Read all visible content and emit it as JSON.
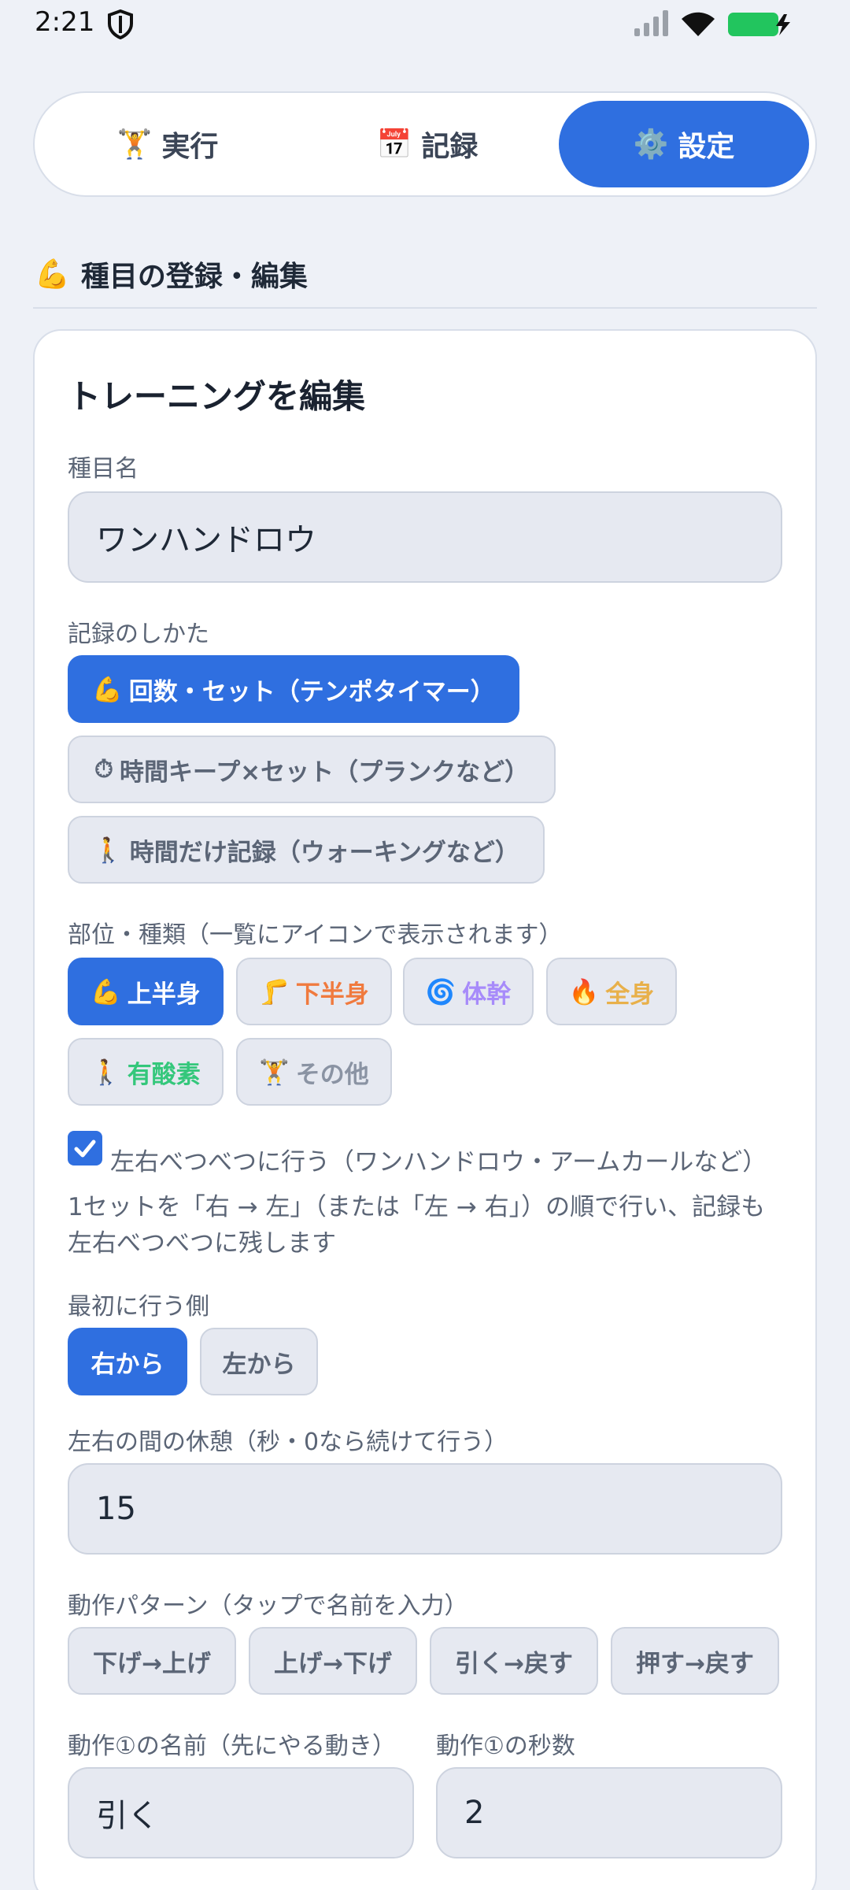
{
  "status": {
    "time": "2:21",
    "shield_icon": "shield-icon",
    "signal_icon": "signal-icon",
    "wifi_icon": "wifi-icon",
    "battery_icon": "battery-charging-icon",
    "battery_color": "#22c55e"
  },
  "tabs": [
    {
      "icon": "🏋️",
      "label": "実行"
    },
    {
      "icon": "📅",
      "label": "記録"
    },
    {
      "icon": "⚙️",
      "label": "設定"
    }
  ],
  "section": {
    "icon": "💪",
    "title": "種目の登録・編集"
  },
  "card": {
    "title": "トレーニングを編集",
    "name_label": "種目名",
    "name_value": "ワンハンドロウ",
    "record_label": "記録のしかた",
    "record_options": [
      {
        "icon": "💪",
        "label": "回数・セット（テンポタイマー）"
      },
      {
        "icon": "⏱",
        "label": "時間キープ×セット（プランクなど）"
      },
      {
        "icon": "🚶",
        "label": "時間だけ記録（ウォーキングなど）"
      }
    ],
    "part_label": "部位・種類（一覧にアイコンで表示されます）",
    "parts": [
      {
        "icon": "💪",
        "label": "上半身",
        "color": "#ffffff"
      },
      {
        "icon": "🦵",
        "label": "下半身",
        "color": "#f07a3e"
      },
      {
        "icon": "🌀",
        "label": "体幹",
        "color": "#a78bfa"
      },
      {
        "icon": "🔥",
        "label": "全身",
        "color": "#e8b04a"
      },
      {
        "icon": "🚶",
        "label": "有酸素",
        "color": "#34c77b"
      },
      {
        "icon": "🏋️",
        "label": "その他",
        "color": "#8a93a3"
      }
    ],
    "lr_checkbox_label": "左右べつべつに行う（ワンハンドロウ・アームカールなど）",
    "lr_note_line1": "1セットを「右 → 左」（または「左 → 右」）の順で行い、記録も",
    "lr_note_line2": "左右べつべつに残します",
    "first_side_label": "最初に行う側",
    "first_side_options": [
      "右から",
      "左から"
    ],
    "rest_label": "左右の間の休憩（秒・0なら続けて行う）",
    "rest_value": "15",
    "pattern_label": "動作パターン（タップで名前を入力）",
    "patterns": [
      "下げ→上げ",
      "上げ→下げ",
      "引く→戻す",
      "押す→戻す"
    ],
    "motion1_name_label": "動作①の名前（先にやる動き）",
    "motion1_name_value": "引く",
    "motion1_sec_label": "動作①の秒数",
    "motion1_sec_value": "2"
  },
  "colors": {
    "accent": "#2f6fe0",
    "background": "#eef1f7"
  }
}
